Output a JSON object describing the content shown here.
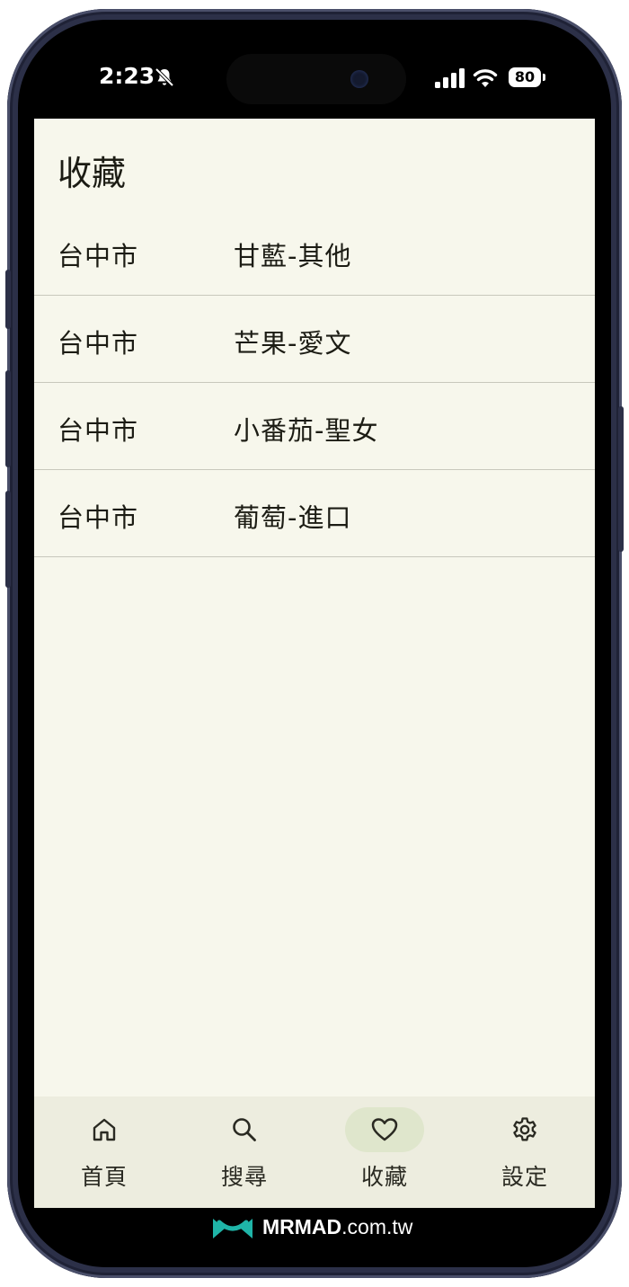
{
  "status_bar": {
    "time": "2:23",
    "battery": "80"
  },
  "page": {
    "title": "收藏"
  },
  "favorites": [
    {
      "city": "台中市",
      "product": "甘藍-其他"
    },
    {
      "city": "台中市",
      "product": "芒果-愛文"
    },
    {
      "city": "台中市",
      "product": "小番茄-聖女"
    },
    {
      "city": "台中市",
      "product": "葡萄-進口"
    }
  ],
  "nav": {
    "items": [
      {
        "label": "首頁",
        "icon": "home-icon"
      },
      {
        "label": "搜尋",
        "icon": "search-icon"
      },
      {
        "label": "收藏",
        "icon": "heart-icon",
        "active": true
      },
      {
        "label": "設定",
        "icon": "gear-icon"
      }
    ]
  },
  "watermark": {
    "brand": "MRMAD",
    "suffix": ".com.tw"
  },
  "colors": {
    "app_background": "#f7f7ec",
    "nav_background": "#ededdf",
    "nav_active_pill": "#dfe6cc",
    "watermark_logo": "#1fb5a8"
  }
}
